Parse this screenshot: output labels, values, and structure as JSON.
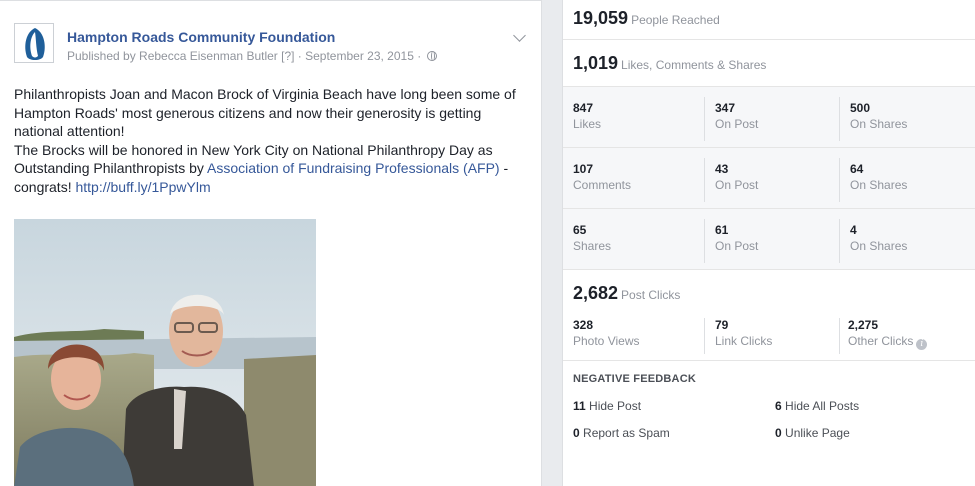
{
  "post": {
    "page_name": "Hampton Roads Community Foundation",
    "byline": "Published by Rebecca Eisenman Butler [?] · September 23, 2015 ·",
    "globe_icon": "globe-icon",
    "menu_icon": "chevron-down-icon",
    "text_line1": "Philanthropists Joan and Macon Brock of Virginia Beach have long been some of Hampton Roads' most generous citizens and now their generosity is getting national attention!",
    "text_line2_prefix": "The Brocks will be honored in New York City on National Philanthropy Day as Outstanding Philanthropists by ",
    "text_link1": "Association of Fundraising Professionals (AFP)",
    "text_mid": " - congrats! ",
    "text_link2": "http://buff.ly/1PpwYlm",
    "link_color": "#365899"
  },
  "insights": {
    "reach": {
      "value": "19,059",
      "label": "People Reached"
    },
    "engagement": {
      "value": "1,019",
      "label": "Likes, Comments & Shares"
    },
    "rows": [
      {
        "total": "847",
        "total_label": "Likes",
        "on_post": "347",
        "on_post_label": "On Post",
        "on_shares": "500",
        "on_shares_label": "On Shares"
      },
      {
        "total": "107",
        "total_label": "Comments",
        "on_post": "43",
        "on_post_label": "On Post",
        "on_shares": "64",
        "on_shares_label": "On Shares"
      },
      {
        "total": "65",
        "total_label": "Shares",
        "on_post": "61",
        "on_post_label": "On Post",
        "on_shares": "4",
        "on_shares_label": "On Shares"
      }
    ],
    "post_clicks": {
      "value": "2,682",
      "label": "Post Clicks",
      "photo_views": "328",
      "photo_views_label": "Photo Views",
      "link_clicks": "79",
      "link_clicks_label": "Link Clicks",
      "other_clicks": "2,275",
      "other_clicks_label": "Other Clicks",
      "info_icon": "i"
    },
    "negative_feedback": {
      "title": "NEGATIVE FEEDBACK",
      "hide_post": "11",
      "hide_post_label": "Hide Post",
      "hide_all": "6",
      "hide_all_label": "Hide All Posts",
      "report_spam": "0",
      "report_spam_label": "Report as Spam",
      "unlike_page": "0",
      "unlike_page_label": "Unlike Page"
    }
  }
}
